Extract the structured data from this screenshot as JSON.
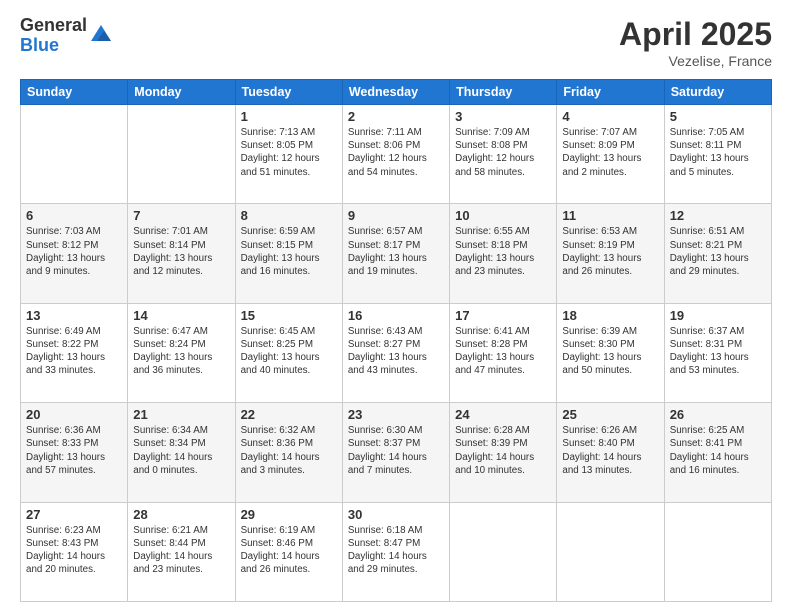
{
  "header": {
    "logo_general": "General",
    "logo_blue": "Blue",
    "title": "April 2025",
    "location": "Vezelise, France"
  },
  "days_of_week": [
    "Sunday",
    "Monday",
    "Tuesday",
    "Wednesday",
    "Thursday",
    "Friday",
    "Saturday"
  ],
  "weeks": [
    [
      {
        "day": "",
        "info": ""
      },
      {
        "day": "",
        "info": ""
      },
      {
        "day": "1",
        "info": "Sunrise: 7:13 AM\nSunset: 8:05 PM\nDaylight: 12 hours and 51 minutes."
      },
      {
        "day": "2",
        "info": "Sunrise: 7:11 AM\nSunset: 8:06 PM\nDaylight: 12 hours and 54 minutes."
      },
      {
        "day": "3",
        "info": "Sunrise: 7:09 AM\nSunset: 8:08 PM\nDaylight: 12 hours and 58 minutes."
      },
      {
        "day": "4",
        "info": "Sunrise: 7:07 AM\nSunset: 8:09 PM\nDaylight: 13 hours and 2 minutes."
      },
      {
        "day": "5",
        "info": "Sunrise: 7:05 AM\nSunset: 8:11 PM\nDaylight: 13 hours and 5 minutes."
      }
    ],
    [
      {
        "day": "6",
        "info": "Sunrise: 7:03 AM\nSunset: 8:12 PM\nDaylight: 13 hours and 9 minutes."
      },
      {
        "day": "7",
        "info": "Sunrise: 7:01 AM\nSunset: 8:14 PM\nDaylight: 13 hours and 12 minutes."
      },
      {
        "day": "8",
        "info": "Sunrise: 6:59 AM\nSunset: 8:15 PM\nDaylight: 13 hours and 16 minutes."
      },
      {
        "day": "9",
        "info": "Sunrise: 6:57 AM\nSunset: 8:17 PM\nDaylight: 13 hours and 19 minutes."
      },
      {
        "day": "10",
        "info": "Sunrise: 6:55 AM\nSunset: 8:18 PM\nDaylight: 13 hours and 23 minutes."
      },
      {
        "day": "11",
        "info": "Sunrise: 6:53 AM\nSunset: 8:19 PM\nDaylight: 13 hours and 26 minutes."
      },
      {
        "day": "12",
        "info": "Sunrise: 6:51 AM\nSunset: 8:21 PM\nDaylight: 13 hours and 29 minutes."
      }
    ],
    [
      {
        "day": "13",
        "info": "Sunrise: 6:49 AM\nSunset: 8:22 PM\nDaylight: 13 hours and 33 minutes."
      },
      {
        "day": "14",
        "info": "Sunrise: 6:47 AM\nSunset: 8:24 PM\nDaylight: 13 hours and 36 minutes."
      },
      {
        "day": "15",
        "info": "Sunrise: 6:45 AM\nSunset: 8:25 PM\nDaylight: 13 hours and 40 minutes."
      },
      {
        "day": "16",
        "info": "Sunrise: 6:43 AM\nSunset: 8:27 PM\nDaylight: 13 hours and 43 minutes."
      },
      {
        "day": "17",
        "info": "Sunrise: 6:41 AM\nSunset: 8:28 PM\nDaylight: 13 hours and 47 minutes."
      },
      {
        "day": "18",
        "info": "Sunrise: 6:39 AM\nSunset: 8:30 PM\nDaylight: 13 hours and 50 minutes."
      },
      {
        "day": "19",
        "info": "Sunrise: 6:37 AM\nSunset: 8:31 PM\nDaylight: 13 hours and 53 minutes."
      }
    ],
    [
      {
        "day": "20",
        "info": "Sunrise: 6:36 AM\nSunset: 8:33 PM\nDaylight: 13 hours and 57 minutes."
      },
      {
        "day": "21",
        "info": "Sunrise: 6:34 AM\nSunset: 8:34 PM\nDaylight: 14 hours and 0 minutes."
      },
      {
        "day": "22",
        "info": "Sunrise: 6:32 AM\nSunset: 8:36 PM\nDaylight: 14 hours and 3 minutes."
      },
      {
        "day": "23",
        "info": "Sunrise: 6:30 AM\nSunset: 8:37 PM\nDaylight: 14 hours and 7 minutes."
      },
      {
        "day": "24",
        "info": "Sunrise: 6:28 AM\nSunset: 8:39 PM\nDaylight: 14 hours and 10 minutes."
      },
      {
        "day": "25",
        "info": "Sunrise: 6:26 AM\nSunset: 8:40 PM\nDaylight: 14 hours and 13 minutes."
      },
      {
        "day": "26",
        "info": "Sunrise: 6:25 AM\nSunset: 8:41 PM\nDaylight: 14 hours and 16 minutes."
      }
    ],
    [
      {
        "day": "27",
        "info": "Sunrise: 6:23 AM\nSunset: 8:43 PM\nDaylight: 14 hours and 20 minutes."
      },
      {
        "day": "28",
        "info": "Sunrise: 6:21 AM\nSunset: 8:44 PM\nDaylight: 14 hours and 23 minutes."
      },
      {
        "day": "29",
        "info": "Sunrise: 6:19 AM\nSunset: 8:46 PM\nDaylight: 14 hours and 26 minutes."
      },
      {
        "day": "30",
        "info": "Sunrise: 6:18 AM\nSunset: 8:47 PM\nDaylight: 14 hours and 29 minutes."
      },
      {
        "day": "",
        "info": ""
      },
      {
        "day": "",
        "info": ""
      },
      {
        "day": "",
        "info": ""
      }
    ]
  ]
}
